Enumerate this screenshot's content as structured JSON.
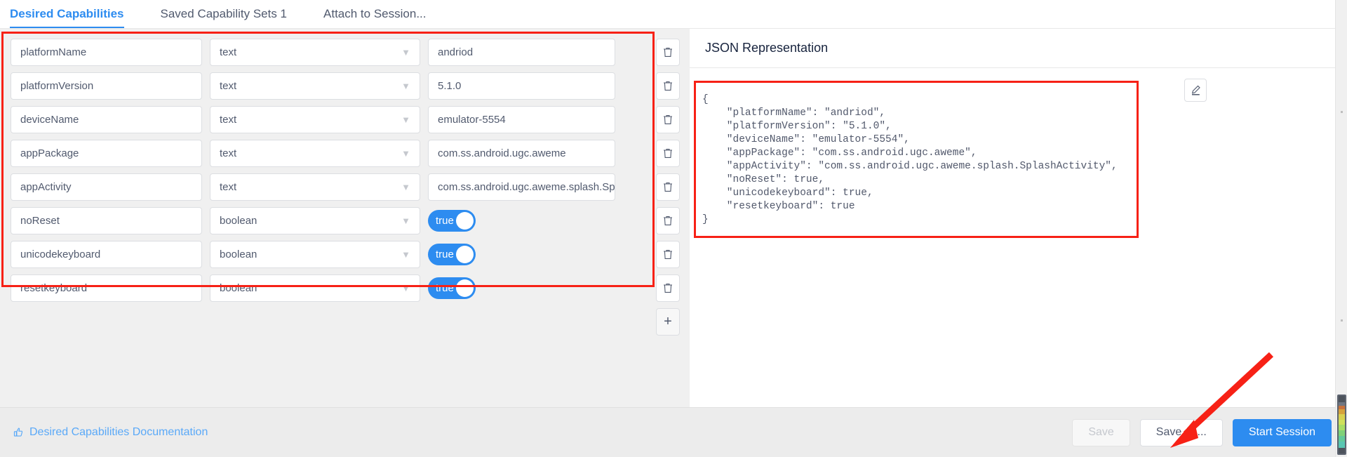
{
  "tabs": [
    {
      "label": "Desired Capabilities",
      "active": true
    },
    {
      "label": "Saved Capability Sets 1",
      "active": false
    },
    {
      "label": "Attach to Session...",
      "active": false
    }
  ],
  "capabilities": [
    {
      "name": "platformName",
      "type": "text",
      "value": "andriod"
    },
    {
      "name": "platformVersion",
      "type": "text",
      "value": "5.1.0"
    },
    {
      "name": "deviceName",
      "type": "text",
      "value": "emulator-5554"
    },
    {
      "name": "appPackage",
      "type": "text",
      "value": "com.ss.android.ugc.aweme"
    },
    {
      "name": "appActivity",
      "type": "text",
      "value": "com.ss.android.ugc.aweme.splash.Sp"
    },
    {
      "name": "noReset",
      "type": "boolean",
      "value": "true"
    },
    {
      "name": "unicodekeyboard",
      "type": "boolean",
      "value": "true"
    },
    {
      "name": "resetkeyboard",
      "type": "boolean",
      "value": "true"
    }
  ],
  "row_actions": {
    "delete_icon": "trash-icon",
    "add_label": "+"
  },
  "json_panel": {
    "title": "JSON Representation",
    "edit_icon": "pencil-icon",
    "content": "{\n    \"platformName\": \"andriod\",\n    \"platformVersion\": \"5.1.0\",\n    \"deviceName\": \"emulator-5554\",\n    \"appPackage\": \"com.ss.android.ugc.aweme\",\n    \"appActivity\": \"com.ss.android.ugc.aweme.splash.SplashActivity\",\n    \"noReset\": true,\n    \"unicodekeyboard\": true,\n    \"resetkeyboard\": true\n}"
  },
  "footer": {
    "doc_link": "Desired Capabilities Documentation",
    "doc_icon": "thumbs-up-icon",
    "save_label": "Save",
    "save_as_label": "Save As...",
    "start_session_label": "Start Session"
  },
  "colors": {
    "accent": "#2d8cf0",
    "annotation": "#f72116",
    "toggle_on": "#2d8cf0",
    "link": "#5aa9f8"
  }
}
